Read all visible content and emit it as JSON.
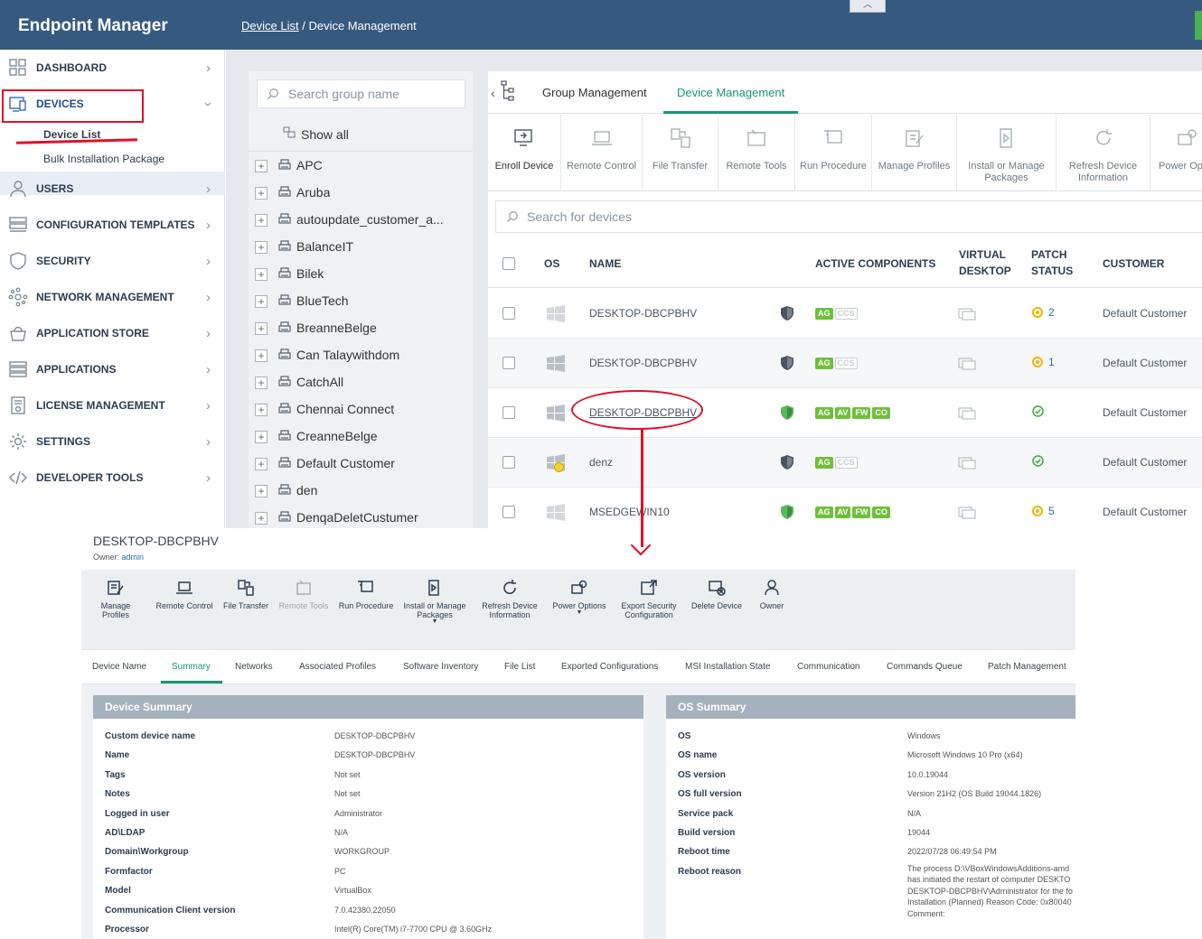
{
  "app": {
    "title": "Endpoint Manager"
  },
  "breadcrumb": {
    "link": "Device List",
    "separator": "/",
    "current": "Device Management"
  },
  "sidebar": {
    "items": [
      {
        "label": "DASHBOARD",
        "icon": "dashboard-icon"
      },
      {
        "label": "DEVICES",
        "icon": "devices-icon",
        "expanded": true
      },
      {
        "label": "USERS",
        "icon": "user-icon"
      },
      {
        "label": "CONFIGURATION TEMPLATES",
        "icon": "templates-icon"
      },
      {
        "label": "SECURITY",
        "icon": "shield-icon"
      },
      {
        "label": "NETWORK MANAGEMENT",
        "icon": "network-icon"
      },
      {
        "label": "APPLICATION STORE",
        "icon": "store-icon"
      },
      {
        "label": "APPLICATIONS",
        "icon": "applications-icon"
      },
      {
        "label": "LICENSE MANAGEMENT",
        "icon": "license-icon"
      },
      {
        "label": "SETTINGS",
        "icon": "gear-icon"
      },
      {
        "label": "DEVELOPER TOOLS",
        "icon": "code-icon"
      }
    ],
    "subitems": [
      "Device List",
      "Bulk Installation Package"
    ]
  },
  "groups": {
    "search_placeholder": "Search group name",
    "show_all": "Show all",
    "items": [
      "APC",
      "Aruba",
      "autoupdate_customer_a...",
      "BalanceIT",
      "Bilek",
      "BlueTech",
      "BreanneBelge",
      "Can Talaywithdom",
      "CatchAll",
      "Chennai Connect",
      "CreanneBelge",
      "Default Customer",
      "den",
      "DenqaDeletCustumer"
    ]
  },
  "main": {
    "tabs": [
      "Group Management",
      "Device Management"
    ],
    "active_tab": "Device Management",
    "toolbar": [
      "Enroll Device",
      "Remote Control",
      "File Transfer",
      "Remote Tools",
      "Run Procedure",
      "Manage Profiles",
      "Install or Manage Packages",
      "Refresh Device Information",
      "Power Op"
    ],
    "search_placeholder": "Search for devices",
    "columns": {
      "os": "OS",
      "name": "NAME",
      "active_components": "ACTIVE COMPONENTS",
      "virtual_desktop": "VIRTUAL DESKTOP",
      "patch_status": "PATCH STATUS",
      "customer": "CUSTOMER"
    },
    "rows": [
      {
        "name": "DESKTOP-DBCPBHV",
        "components": [
          "AG",
          "CCS"
        ],
        "patch": "2",
        "customer": "Default Customer"
      },
      {
        "name": "DESKTOP-DBCPBHV",
        "components": [
          "AG",
          "CCS"
        ],
        "patch": "1",
        "customer": "Default Customer"
      },
      {
        "name": "DESKTOP-DBCPBHV",
        "components": [
          "AG",
          "AV",
          "FW",
          "CO"
        ],
        "patch": "",
        "customer": "Default Customer"
      },
      {
        "name": "denz",
        "components": [
          "AG",
          "CCS"
        ],
        "patch": "",
        "customer": "Default Customer"
      },
      {
        "name": "MSEDGEWIN10",
        "components": [
          "AG",
          "AV",
          "FW",
          "CO"
        ],
        "patch": "5",
        "customer": "Default Customer"
      }
    ]
  },
  "device": {
    "title": "DESKTOP-DBCPBHV",
    "owner_label": "Owner:",
    "owner": "admin",
    "toolbar": [
      "Manage Profiles",
      "Remote Control",
      "File Transfer",
      "Remote Tools",
      "Run Procedure",
      "Install or Manage Packages",
      "Refresh Device Information",
      "Power Options",
      "Export Security Configuration",
      "Delete Device",
      "Owner"
    ],
    "tabs": [
      "Device Name",
      "Summary",
      "Networks",
      "Associated Profiles",
      "Software Inventory",
      "File List",
      "Exported Configurations",
      "MSI Installation State",
      "Communication",
      "Commands Queue",
      "Patch Management"
    ],
    "active_tab": "Summary",
    "summary": {
      "title": "Device Summary",
      "fields": [
        {
          "k": "Custom device name",
          "v": "DESKTOP-DBCPBHV"
        },
        {
          "k": "Name",
          "v": "DESKTOP-DBCPBHV"
        },
        {
          "k": "Tags",
          "v": "Not set"
        },
        {
          "k": "Notes",
          "v": "Not set"
        },
        {
          "k": "Logged in user",
          "v": "Administrator"
        },
        {
          "k": "AD\\LDAP",
          "v": "N/A"
        },
        {
          "k": "Domain\\Workgroup",
          "v": "WORKGROUP"
        },
        {
          "k": "Formfactor",
          "v": "PC"
        },
        {
          "k": "Model",
          "v": "VirtualBox"
        },
        {
          "k": "Communication Client version",
          "v": "7.0.42380.22050"
        },
        {
          "k": "Processor",
          "v": "Intel(R) Core(TM) i7-7700 CPU @ 3.60GHz"
        }
      ]
    },
    "os": {
      "title": "OS Summary",
      "fields": [
        {
          "k": "OS",
          "v": "Windows"
        },
        {
          "k": "OS name",
          "v": "Microsoft Windows 10 Pro (x64)"
        },
        {
          "k": "OS version",
          "v": "10.0.19044"
        },
        {
          "k": "OS full version",
          "v": "Version 21H2 (OS Build 19044.1826)"
        },
        {
          "k": "Service pack",
          "v": "N/A"
        },
        {
          "k": "Build version",
          "v": "19044"
        },
        {
          "k": "Reboot time",
          "v": "2022/07/28 06:49:54 PM"
        },
        {
          "k": "Reboot reason",
          "v": "The process D:\\VBoxWindowsAdditions-amd has initiated the restart of computer DESKTO DESKTOP-DBCPBHV\\Administrator for the fo Installation (Planned) Reason Code: 0x80040 Comment:"
        }
      ]
    }
  },
  "colors": {
    "accent": "#1a9478",
    "topbar": "#36597f",
    "annotation": "#e0102a",
    "badge_green": "#6fbf3b"
  }
}
